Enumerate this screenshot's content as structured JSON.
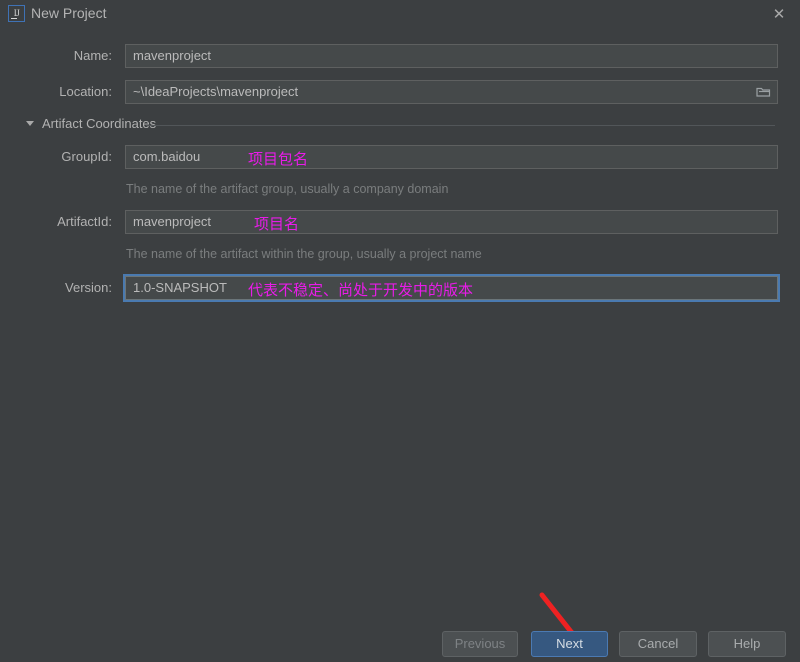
{
  "window": {
    "title": "New Project",
    "app_icon": "intellij-idea-icon",
    "close_icon": "close-icon"
  },
  "form": {
    "name": {
      "label": "Name:",
      "value": "mavenproject"
    },
    "location": {
      "label": "Location:",
      "value": "~\\IdeaProjects\\mavenproject",
      "browse_icon": "folder-icon"
    },
    "section": {
      "label": "Artifact Coordinates",
      "expanded": true,
      "toggle_icon": "chevron-down-icon"
    },
    "group_id": {
      "label": "GroupId:",
      "value": "com.baidou",
      "helper": "The name of the artifact group, usually a company domain"
    },
    "artifact_id": {
      "label": "ArtifactId:",
      "value": "mavenproject",
      "helper": "The name of the artifact within the group, usually a project name"
    },
    "version": {
      "label": "Version:",
      "value": "1.0-SNAPSHOT",
      "focused": true
    }
  },
  "annotations": {
    "color": "#e81ce8",
    "group_id_note": "项目包名",
    "artifact_id_note": "项目名",
    "version_note": "代表不稳定、尚处于开发中的版本",
    "arrow_color": "#ee2222",
    "arrow_target": "next-button"
  },
  "buttons": {
    "previous": "Previous",
    "next": "Next",
    "cancel": "Cancel",
    "help": "Help"
  },
  "theme": {
    "background": "#3c3f41",
    "field_background": "#45494a",
    "accent": "#365880",
    "focus_ring": "#4a7ab0"
  }
}
